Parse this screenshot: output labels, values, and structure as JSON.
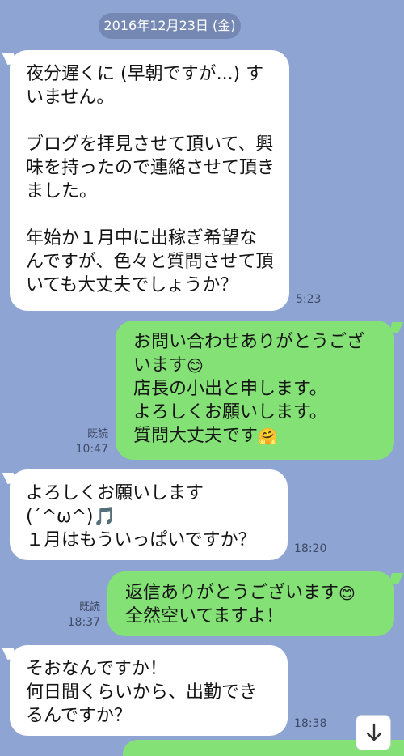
{
  "chat": {
    "date": "2016年12月23日 (金)",
    "messages": [
      {
        "direction": "incoming",
        "text": "夜分遅くに (早朝ですが...) すいません。\n\nブログを拝見させて頂いて、興味を持ったので連絡させて頂きました。\n\n年始か１月中に出稼ぎ希望なんですが、色々と質問させて頂いても大丈夫でしょうか？",
        "time": "5:23"
      },
      {
        "direction": "outgoing",
        "text_before_emoji": "お問い合わせありがとうございます",
        "emoji_1": "😊",
        "text_middle": "\n店長の小出と申します。\nよろしくお願いします。\n質問大丈夫です",
        "emoji_2": "🤗",
        "read_label": "既読",
        "time": "10:47"
      },
      {
        "direction": "incoming",
        "text": "よろしくお願いします\n(´^ω^)🎵\n１月はもういっぱいですか？",
        "time": "18:20"
      },
      {
        "direction": "outgoing",
        "text_before_emoji": "返信ありがとうございます",
        "emoji_1": "😊",
        "text_middle": "\n全然空いてますよ！",
        "read_label": "既読",
        "time": "18:37"
      },
      {
        "direction": "incoming",
        "text": "そおなんですか！\n何日間くらいから、出勤できるんですか？",
        "time": "18:38"
      }
    ]
  },
  "colors": {
    "background": "#8ea5d3",
    "outgoing_bubble": "#84e176",
    "incoming_bubble": "#ffffff",
    "date_pill": "#7588b4"
  },
  "icons": {
    "scroll_down": "arrow-down-icon"
  }
}
